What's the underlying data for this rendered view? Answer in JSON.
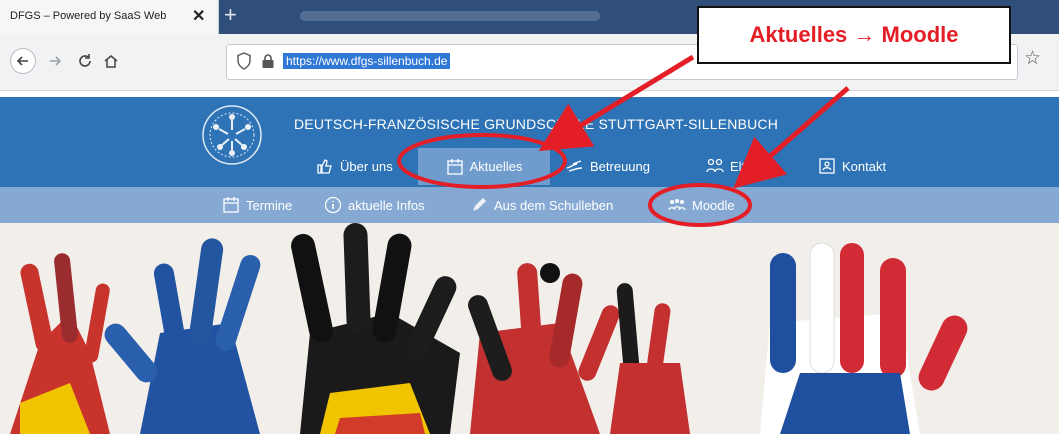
{
  "browser": {
    "tab_title": "DFGS – Powered by SaaS Web",
    "tab_close": "✕",
    "new_tab": "+",
    "url": "https://www.dfgs-sillenbuch.de"
  },
  "site": {
    "school_name": "DEUTSCH-FRANZÖSISCHE GRUNDSCHULE STUTTGART-SILLENBUCH",
    "main_nav": [
      {
        "label": "Über uns"
      },
      {
        "label": "Aktuelles"
      },
      {
        "label": "Betreuung"
      },
      {
        "label": "Eltern"
      },
      {
        "label": "Kontakt"
      }
    ],
    "sub_nav": [
      {
        "label": "Termine"
      },
      {
        "label": "aktuelle Infos"
      },
      {
        "label": "Aus dem Schulleben"
      },
      {
        "label": "Moodle"
      }
    ]
  },
  "annotation": {
    "callout": "Aktuelles → Moodle",
    "color": "#e41e26"
  }
}
